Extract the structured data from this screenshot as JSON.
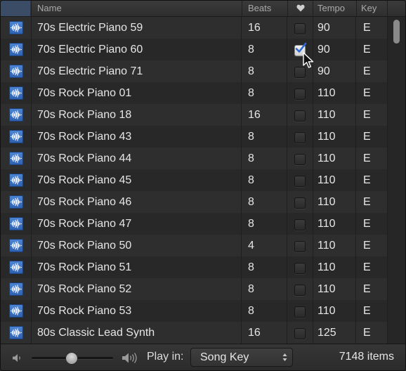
{
  "header": {
    "name": "Name",
    "beats": "Beats",
    "favorite_icon": "heart-icon",
    "tempo": "Tempo",
    "key": "Key"
  },
  "rows": [
    {
      "name": "70s Electric Piano 59",
      "beats": "16",
      "favorite": false,
      "tempo": "90",
      "key": "E"
    },
    {
      "name": "70s Electric Piano 60",
      "beats": "8",
      "favorite": true,
      "tempo": "90",
      "key": "E"
    },
    {
      "name": "70s Electric Piano 71",
      "beats": "8",
      "favorite": false,
      "tempo": "90",
      "key": "E"
    },
    {
      "name": "70s Rock Piano 01",
      "beats": "8",
      "favorite": false,
      "tempo": "110",
      "key": "E"
    },
    {
      "name": "70s Rock Piano 18",
      "beats": "16",
      "favorite": false,
      "tempo": "110",
      "key": "E"
    },
    {
      "name": "70s Rock Piano 43",
      "beats": "8",
      "favorite": false,
      "tempo": "110",
      "key": "E"
    },
    {
      "name": "70s Rock Piano 44",
      "beats": "8",
      "favorite": false,
      "tempo": "110",
      "key": "E"
    },
    {
      "name": "70s Rock Piano 45",
      "beats": "8",
      "favorite": false,
      "tempo": "110",
      "key": "E"
    },
    {
      "name": "70s Rock Piano 46",
      "beats": "8",
      "favorite": false,
      "tempo": "110",
      "key": "E"
    },
    {
      "name": "70s Rock Piano 47",
      "beats": "8",
      "favorite": false,
      "tempo": "110",
      "key": "E"
    },
    {
      "name": "70s Rock Piano 50",
      "beats": "4",
      "favorite": false,
      "tempo": "110",
      "key": "E"
    },
    {
      "name": "70s Rock Piano 51",
      "beats": "8",
      "favorite": false,
      "tempo": "110",
      "key": "E"
    },
    {
      "name": "70s Rock Piano 52",
      "beats": "8",
      "favorite": false,
      "tempo": "110",
      "key": "E"
    },
    {
      "name": "70s Rock Piano 53",
      "beats": "8",
      "favorite": false,
      "tempo": "110",
      "key": "E"
    },
    {
      "name": "80s Classic Lead Synth",
      "beats": "16",
      "favorite": false,
      "tempo": "125",
      "key": "E"
    }
  ],
  "footer": {
    "volume_low_icon": "speaker-low-icon",
    "volume_high_icon": "speaker-high-icon",
    "volume_level": 0.48,
    "play_in_label": "Play in:",
    "play_in_value": "Song Key",
    "item_count": "7148 items"
  },
  "colors": {
    "loop_icon_blue": "#3a72c8",
    "header_icon_col": "#3b4d66",
    "background": "#2c2c2c"
  }
}
